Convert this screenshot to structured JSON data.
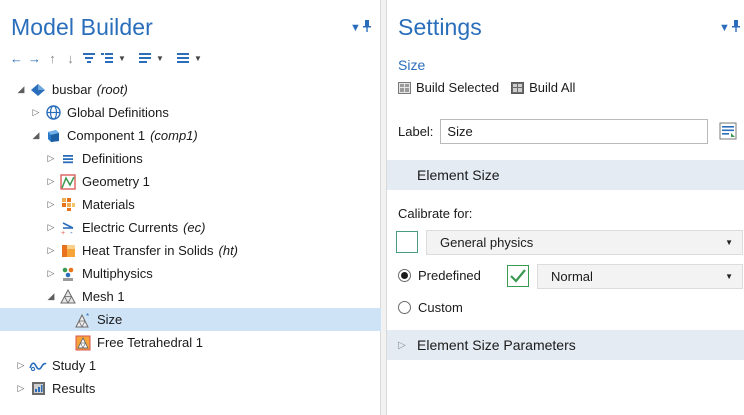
{
  "model_builder": {
    "title": "Model Builder",
    "toolbar": [
      "back-arrow",
      "forward-arrow",
      "up-arrow",
      "down-arrow",
      "show-icon",
      "expand-icon",
      "collapse-icon",
      "list-icon"
    ],
    "tree": [
      {
        "label": "busbar",
        "suffix": "(root)",
        "level": 0,
        "twisty": "expanded",
        "icon": "model-root-icon"
      },
      {
        "label": "Global Definitions",
        "suffix": "",
        "level": 1,
        "twisty": "collapsed",
        "icon": "globe-icon"
      },
      {
        "label": "Component 1",
        "suffix": "(comp1)",
        "level": 1,
        "twisty": "expanded",
        "icon": "component-icon"
      },
      {
        "label": "Definitions",
        "suffix": "",
        "level": 2,
        "twisty": "collapsed",
        "icon": "definitions-icon"
      },
      {
        "label": "Geometry 1",
        "suffix": "",
        "level": 2,
        "twisty": "collapsed",
        "icon": "geometry-icon"
      },
      {
        "label": "Materials",
        "suffix": "",
        "level": 2,
        "twisty": "collapsed",
        "icon": "materials-icon"
      },
      {
        "label": "Electric Currents",
        "suffix": "(ec)",
        "level": 2,
        "twisty": "collapsed",
        "icon": "electric-currents-icon"
      },
      {
        "label": "Heat Transfer in Solids",
        "suffix": "(ht)",
        "level": 2,
        "twisty": "collapsed",
        "icon": "heat-transfer-icon"
      },
      {
        "label": "Multiphysics",
        "suffix": "",
        "level": 2,
        "twisty": "collapsed",
        "icon": "multiphysics-icon"
      },
      {
        "label": "Mesh 1",
        "suffix": "",
        "level": 2,
        "twisty": "expanded",
        "icon": "mesh-icon"
      },
      {
        "label": "Size",
        "suffix": "",
        "level": 3,
        "twisty": "none",
        "icon": "size-icon",
        "selected": true
      },
      {
        "label": "Free Tetrahedral 1",
        "suffix": "",
        "level": 3,
        "twisty": "none",
        "icon": "free-tetrahedral-icon"
      },
      {
        "label": "Study 1",
        "suffix": "",
        "level": 1,
        "twisty": "collapsed",
        "icon": "study-icon"
      },
      {
        "label": "Results",
        "suffix": "",
        "level": 1,
        "twisty": "collapsed",
        "icon": "results-icon"
      }
    ]
  },
  "settings": {
    "title": "Settings",
    "subtitle": "Size",
    "build_selected": "Build Selected",
    "build_all": "Build All",
    "label_caption": "Label:",
    "label_value": "Size",
    "section_element_size": "Element Size",
    "calibrate_for": "Calibrate for:",
    "calibrate_value": "General physics",
    "predefined": "Predefined",
    "predefined_value": "Normal",
    "custom": "Custom",
    "selected_radio": "Predefined",
    "section_parameters": "Element Size Parameters"
  },
  "colors": {
    "accent": "#2a6ebb",
    "selection": "#cfe3f7",
    "section_bg": "#e4ebf3",
    "check_green": "#3a9a52"
  }
}
